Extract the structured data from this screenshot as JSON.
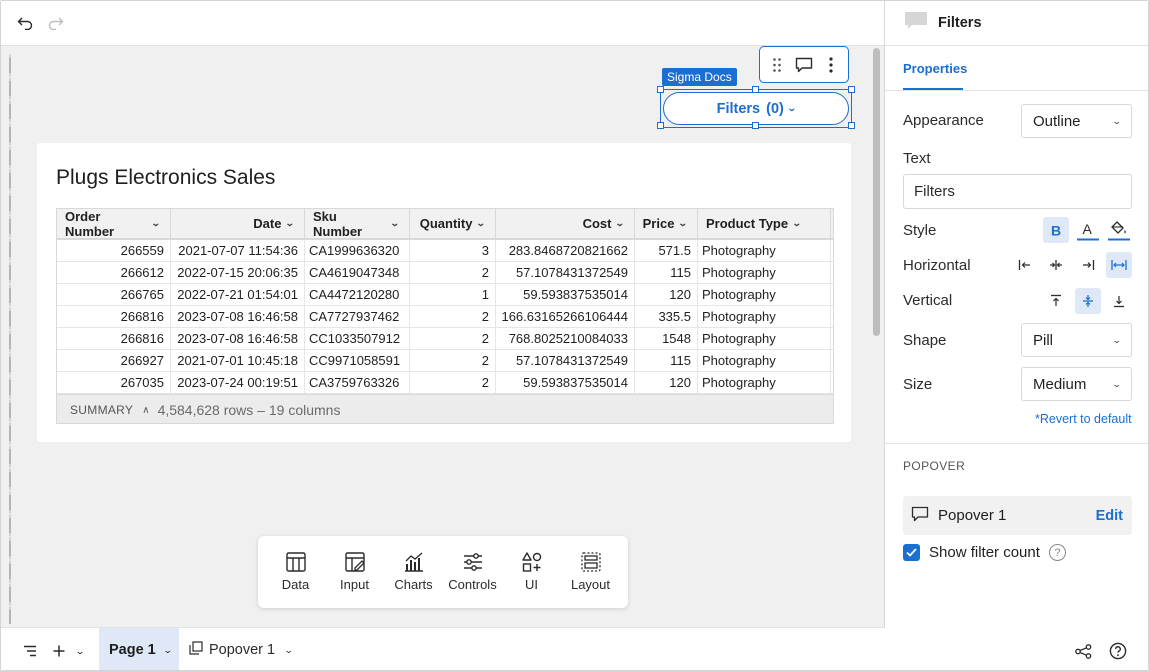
{
  "canvas": {
    "element_tag": "Sigma Docs",
    "filters_button": {
      "label": "Filters",
      "count": "(0)"
    }
  },
  "table": {
    "title": "Plugs Electronics Sales",
    "columns": [
      "Order Number",
      "Date",
      "Sku Number",
      "Quantity",
      "Cost",
      "Price",
      "Product Type"
    ],
    "rows": [
      [
        "266559",
        "2021-07-07 11:54:36",
        "CA1999636320",
        "3",
        "283.8468720821662",
        "571.5",
        "Photography"
      ],
      [
        "266612",
        "2022-07-15 20:06:35",
        "CA4619047348",
        "2",
        "57.1078431372549",
        "115",
        "Photography"
      ],
      [
        "266765",
        "2022-07-21 01:54:01",
        "CA4472120280",
        "1",
        "59.593837535014",
        "120",
        "Photography"
      ],
      [
        "266816",
        "2023-07-08 16:46:58",
        "CA7727937462",
        "2",
        "166.63165266106444",
        "335.5",
        "Photography"
      ],
      [
        "266816",
        "2023-07-08 16:46:58",
        "CC1033507912",
        "2",
        "768.8025210084033",
        "1548",
        "Photography"
      ],
      [
        "266927",
        "2021-07-01 10:45:18",
        "CC9971058591",
        "2",
        "57.1078431372549",
        "115",
        "Photography"
      ],
      [
        "267035",
        "2023-07-24 00:19:51",
        "CA3759763326",
        "2",
        "59.593837535014",
        "120",
        "Photography"
      ]
    ],
    "summary_label": "SUMMARY",
    "summary_count": "4,584,628 rows – 19 columns"
  },
  "add_bar": {
    "items": [
      {
        "label": "Data",
        "icon": "table-icon"
      },
      {
        "label": "Input",
        "icon": "input-table-icon"
      },
      {
        "label": "Charts",
        "icon": "chart-icon"
      },
      {
        "label": "Controls",
        "icon": "sliders-icon"
      },
      {
        "label": "UI",
        "icon": "shapes-icon"
      },
      {
        "label": "Layout",
        "icon": "layout-icon"
      }
    ]
  },
  "bottom": {
    "page_tab": "Page 1",
    "popover_tab": "Popover 1"
  },
  "panel": {
    "title": "Filters",
    "tab_properties": "Properties",
    "appearance_label": "Appearance",
    "appearance_value": "Outline",
    "text_label": "Text",
    "text_value": "Filters",
    "style_label": "Style",
    "horizontal_label": "Horizontal",
    "vertical_label": "Vertical",
    "shape_label": "Shape",
    "shape_value": "Pill",
    "size_label": "Size",
    "size_value": "Medium",
    "revert_link": "*Revert to default",
    "popover_section": "POPOVER",
    "popover_name": "Popover 1",
    "popover_edit": "Edit",
    "show_filter_count_label": "Show filter count",
    "show_filter_count_checked": true
  },
  "colors": {
    "accent": "#1b6fd1",
    "canvas_bg": "#f0f0f0",
    "selected_tab_bg": "#dfe8f6"
  }
}
